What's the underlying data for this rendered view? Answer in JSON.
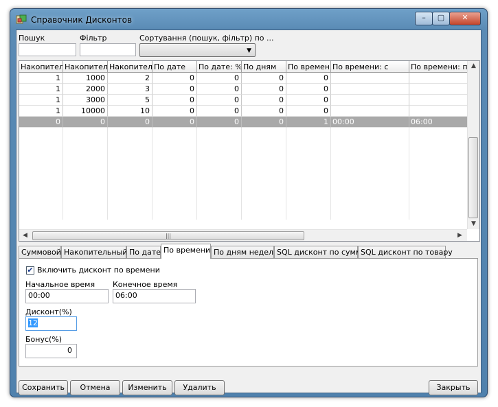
{
  "window": {
    "title": "Справочник Дисконтов",
    "icon": "database-icon",
    "caption_buttons": {
      "minimize": "–",
      "maximize": "▢",
      "close": "✕"
    }
  },
  "filters": {
    "search_label": "Пошук",
    "search_value": "",
    "filter_label": "Фільтр",
    "filter_value": "",
    "sort_label": "Сортування (пошук, фільтр) по ...",
    "sort_value": ""
  },
  "grid": {
    "columns": [
      "Накопитель",
      "Накопитель",
      "Накопитель",
      "По дате",
      "По дате: %",
      "По дням",
      "По времени",
      "По времени: с",
      "По времени: по"
    ],
    "rows": [
      [
        "1",
        "1000",
        "2",
        "0",
        "0",
        "0",
        "0",
        "",
        ""
      ],
      [
        "1",
        "2000",
        "3",
        "0",
        "0",
        "0",
        "0",
        "",
        ""
      ],
      [
        "1",
        "3000",
        "5",
        "0",
        "0",
        "0",
        "0",
        "",
        ""
      ],
      [
        "1",
        "10000",
        "10",
        "0",
        "0",
        "0",
        "0",
        "",
        ""
      ],
      [
        "0",
        "0",
        "0",
        "0",
        "0",
        "0",
        "1",
        "00:00",
        "06:00"
      ]
    ],
    "selected_row": 4,
    "scroll_grip": "|||"
  },
  "tabs": [
    "Суммовой",
    "Накопительный",
    "По дате",
    "По времени",
    "По дням недели",
    "SQL дисконт по сумме",
    "SQL дисконт по товару"
  ],
  "active_tab": "По времени",
  "time_panel": {
    "enable_label": "Включить дисконт по времени",
    "enabled": true,
    "start_label": "Начальное время",
    "start_value": "00:00",
    "end_label": "Конечное время",
    "end_value": "06:00",
    "discount_label": "Дисконт(%)",
    "discount_value": "12",
    "bonus_label": "Бонус(%)",
    "bonus_value": "0"
  },
  "buttons": {
    "save": "Сохранить",
    "cancel": "Отмена",
    "edit": "Изменить",
    "delete": "Удалить",
    "close": "Закрыть"
  }
}
